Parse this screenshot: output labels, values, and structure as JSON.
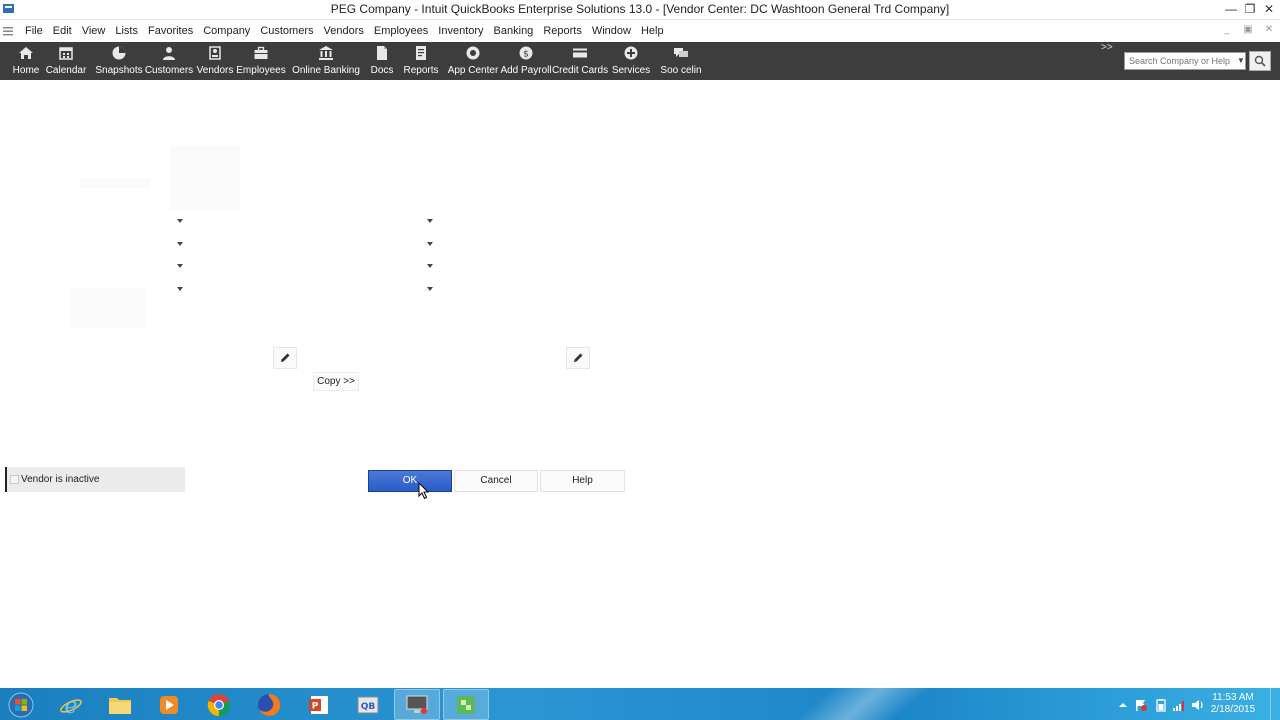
{
  "window": {
    "title": "PEG Company  - Intuit QuickBooks Enterprise Solutions 13.0 - [Vendor Center: DC Washtoon General Trd Company]",
    "minimize_glyph": "—",
    "restore_glyph": "❐",
    "close_glyph": "✕"
  },
  "menubar": {
    "items": [
      "File",
      "Edit",
      "View",
      "Lists",
      "Favorites",
      "Company",
      "Customers",
      "Vendors",
      "Employees",
      "Inventory",
      "Banking",
      "Reports",
      "Window",
      "Help"
    ],
    "mdi_minimize": "_",
    "mdi_restore": "▣",
    "mdi_close": "✕"
  },
  "toolbar": {
    "items": [
      {
        "label": "Home",
        "icon": "home-icon"
      },
      {
        "label": "Calendar",
        "icon": "calendar-icon"
      },
      {
        "label": "Snapshots",
        "icon": "pie-chart-icon"
      },
      {
        "label": "Customers",
        "icon": "person-icon"
      },
      {
        "label": "Vendors",
        "icon": "vendor-icon"
      },
      {
        "label": "Employees",
        "icon": "briefcase-icon"
      },
      {
        "label": "Online Banking",
        "icon": "bank-icon"
      },
      {
        "label": "Docs",
        "icon": "document-icon"
      },
      {
        "label": "Reports",
        "icon": "report-icon"
      },
      {
        "label": "App Center",
        "icon": "app-center-icon"
      },
      {
        "label": "Add Payroll",
        "icon": "payroll-icon"
      },
      {
        "label": "Credit Cards",
        "icon": "credit-card-icon"
      },
      {
        "label": "Services",
        "icon": "plus-circle-icon"
      },
      {
        "label": "Soo celin",
        "icon": "chat-icon"
      }
    ],
    "more_glyph": ">>",
    "search_placeholder": "Search Company or Help"
  },
  "form": {
    "copy_label": "Copy >>",
    "inactive_label": "Vendor is inactive",
    "inactive_checked": false
  },
  "dialog_buttons": {
    "ok": "OK",
    "cancel": "Cancel",
    "help": "Help"
  },
  "taskbar": {
    "pinned": [
      "windows-start",
      "internet-explorer",
      "file-explorer",
      "media-player",
      "chrome",
      "firefox",
      "powerpoint",
      "quickbooks",
      "remote-desktop",
      "green-app"
    ],
    "clock_time": "11:53 AM",
    "clock_date": "2/18/2015"
  }
}
